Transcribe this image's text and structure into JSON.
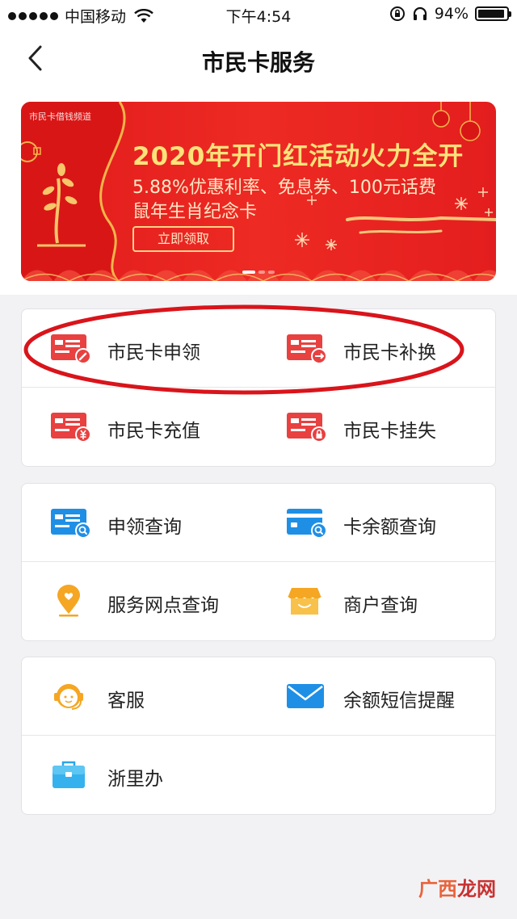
{
  "status_bar": {
    "carrier": "中国移动",
    "time": "下午4:54",
    "battery": "94%",
    "battery_level": 0.94
  },
  "nav": {
    "title": "市民卡服务"
  },
  "banner": {
    "tag": "市民卡借钱频道",
    "title": "2020年开门红活动火力全开",
    "subtitle_line1": "5.88%优惠利率、免息券、100元话费",
    "subtitle_line2": "鼠年生肖纪念卡",
    "button": "立即领取",
    "pages": 3,
    "active_page": 1
  },
  "sections": [
    {
      "items": [
        {
          "label": "市民卡申领",
          "icon": "card-apply-icon"
        },
        {
          "label": "市民卡补换",
          "icon": "card-replace-icon"
        },
        {
          "label": "市民卡充值",
          "icon": "card-recharge-icon"
        },
        {
          "label": "市民卡挂失",
          "icon": "card-lock-icon"
        }
      ]
    },
    {
      "items": [
        {
          "label": "申领查询",
          "icon": "apply-query-icon"
        },
        {
          "label": "卡余额查询",
          "icon": "balance-query-icon"
        },
        {
          "label": "服务网点查询",
          "icon": "location-pin-icon"
        },
        {
          "label": "商户查询",
          "icon": "shop-icon"
        }
      ]
    },
    {
      "items": [
        {
          "label": "客服",
          "icon": "customer-service-icon"
        },
        {
          "label": "余额短信提醒",
          "icon": "envelope-icon"
        },
        {
          "label": "浙里办",
          "icon": "briefcase-icon"
        }
      ]
    }
  ],
  "watermark": {
    "part1": "广西",
    "part2": "龙网"
  },
  "colors": {
    "card_red": "#e94040",
    "card_blue": "#1f8fe6",
    "pin_yellow": "#f5a623",
    "banner_red": "#e8221f",
    "highlight": "#d9141b"
  }
}
